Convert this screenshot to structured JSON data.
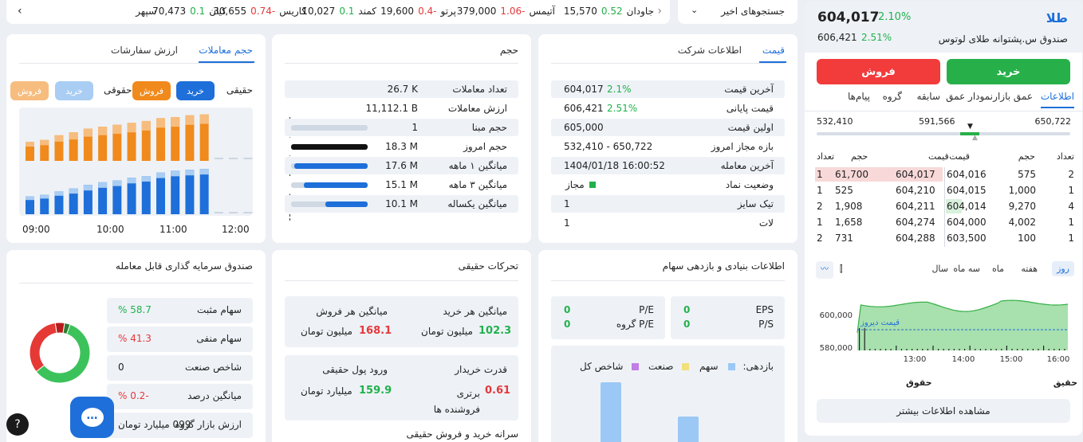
{
  "ticker": {
    "recent_label": "جستجوهای اخیر",
    "items": [
      {
        "name": "جاودان",
        "change": "0.52",
        "value": "15,570",
        "dir": "up"
      },
      {
        "name": "آتیمس",
        "change": "-1.06",
        "value": "379,000",
        "dir": "down"
      },
      {
        "name": "پرتو",
        "change": "-0.4",
        "value": "19,600",
        "dir": "down"
      },
      {
        "name": "کمند",
        "change": "0.1",
        "value": "10,027",
        "dir": "up"
      },
      {
        "name": "کاریس",
        "change": "-0.74",
        "value": "30,655",
        "dir": "down"
      },
      {
        "name": "کیان",
        "change": "0.1",
        "value": "70,473",
        "dir": "up"
      },
      {
        "name": "سپهر",
        "change": "",
        "value": "",
        "dir": "up"
      }
    ]
  },
  "side": {
    "symbol": "طلا",
    "fund_name": "صندوق س.پشتوانه طلای لوتوس",
    "last_price": "604,017",
    "last_change": "2.10%",
    "close_price": "606,421",
    "close_change": "2.51%",
    "buy": "خرید",
    "sell": "فروش",
    "tabs": [
      "اطلاعات",
      "عمق بازار",
      "نمودار عمق",
      "سابقه",
      "گروه",
      "پیام‌ها"
    ],
    "range": {
      "low": "532,410",
      "mid": "591,566",
      "high": "650,722"
    },
    "ob_headers": {
      "count": "تعداد",
      "volume": "حجم",
      "price": "قیمت"
    },
    "orderbook": [
      {
        "bc": "2",
        "bv": "575",
        "bp": "604,016",
        "sp": "604,017",
        "sv": "61,700",
        "sc": "1"
      },
      {
        "bc": "1",
        "bv": "1,000",
        "bp": "604,015",
        "sp": "604,210",
        "sv": "525",
        "sc": "1"
      },
      {
        "bc": "4",
        "bv": "9,270",
        "bp": "604,014",
        "sp": "604,211",
        "sv": "1,908",
        "sc": "2"
      },
      {
        "bc": "1",
        "bv": "4,002",
        "bp": "604,000",
        "sp": "604,274",
        "sv": "1,658",
        "sc": "1"
      },
      {
        "bc": "1",
        "bv": "100",
        "bp": "603,500",
        "sp": "604,288",
        "sv": "731",
        "sc": "2"
      }
    ],
    "periods": [
      "روز",
      "هفته",
      "ماه",
      "سه ماه",
      "سال"
    ],
    "chart_y": [
      "600,000",
      "580,000"
    ],
    "chart_x": [
      "13:00",
      "14:00",
      "15:00",
      "16:00"
    ],
    "yesterday_label": "قیمت دیروز",
    "hq_labels": [
      "حقوق",
      "حقیق"
    ],
    "more": "مشاهده اطلاعات بیشتر"
  },
  "price_card": {
    "tabs": [
      "قیمت",
      "اطلاعات شرکت"
    ],
    "rows": [
      {
        "label": "آخرین قیمت",
        "value": "604,017",
        "change": "2.1%"
      },
      {
        "label": "قیمت پایانی",
        "value": "606,421",
        "change": "2.51%"
      },
      {
        "label": "اولین قیمت",
        "value": "605,000",
        "change": ""
      },
      {
        "label": "بازه مجاز امروز",
        "value": "532,410 - 650,722",
        "change": ""
      },
      {
        "label": "آخرین معامله",
        "value": "1404/01/18 16:00:52",
        "change": ""
      },
      {
        "label": "وضعیت نماد",
        "value": "مجاز",
        "change": ""
      },
      {
        "label": "تیک سایز",
        "value": "1",
        "change": ""
      },
      {
        "label": "لات",
        "value": "1",
        "change": ""
      }
    ]
  },
  "volume_card": {
    "title": "حجم",
    "rows": [
      {
        "label": "تعداد معاملات",
        "value": "26.7 K",
        "fill": 0
      },
      {
        "label": "ارزش معاملات",
        "value": "11,112.1 B",
        "fill": 0
      },
      {
        "label": "حجم مبنا",
        "value": "1",
        "fill": 0.0
      },
      {
        "label": "حجم امروز",
        "value": "18.3 M",
        "fill": 1.0
      },
      {
        "label": "میانگین ۱ ماهه",
        "value": "17.6 M",
        "fill": 0.96
      },
      {
        "label": "میانگین ۳ ماهه",
        "value": "15.1 M",
        "fill": 0.83
      },
      {
        "label": "میانگین یکساله",
        "value": "10.1 M",
        "fill": 0.55
      }
    ]
  },
  "trades_card": {
    "tabs": [
      "حجم معاملات",
      "ارزش سفارشات"
    ],
    "legend": {
      "haghighi1": "حقیقی",
      "kharid": "خرید",
      "forush": "فروش",
      "haghighi2": "حقوقی",
      "kharid2": "خرید",
      "forush2": "فروش"
    },
    "times": [
      "09:00",
      "10:00",
      "11:00",
      "12:00"
    ],
    "sell_vals": [
      20,
      22,
      27,
      30,
      34,
      36,
      38,
      40,
      42,
      45,
      46,
      48,
      49,
      0,
      0,
      0
    ],
    "buy_vals": [
      20,
      22,
      26,
      29,
      33,
      36,
      38,
      41,
      43,
      47,
      49,
      50,
      51,
      0,
      0,
      0
    ]
  },
  "fundamental_card": {
    "title": "اطلاعات بنیادی و بازدهی سهام",
    "eps_label": "EPS",
    "eps": "0",
    "ps_label": "P/S",
    "ps": "0",
    "pe_label": "P/E",
    "pe": "0",
    "peg_label": "P/E گروه",
    "peg": "0",
    "ret_label": "بازدهی:",
    "legend": [
      "سهم",
      "صنعت",
      "شاخص کل"
    ]
  },
  "real_card": {
    "title": "تحرکات حقیقی",
    "avg_buy_label": "میانگین هر خرید",
    "avg_buy": "102.3",
    "avg_buy_unit": "میلیون تومان",
    "avg_sell_label": "میانگین هر فروش",
    "avg_sell": "168.1",
    "avg_sell_unit": "میلیون تومان",
    "power_label": "قدرت خریدار",
    "power": "0.61",
    "power_unit": "برتری فروشنده ها",
    "inflow_label": "ورود پول حقیقی",
    "inflow": "159.9",
    "inflow_unit": "میلیارد تومان",
    "footer": "سرانه خرید و فروش حقیقی"
  },
  "fund_card": {
    "title": "صندوق سرمایه گذاری قابل معامله",
    "rows": [
      {
        "label": "سهام مثبت",
        "value": "58.7 %",
        "tone": "up"
      },
      {
        "label": "سهام منفی",
        "value": "41.3 %",
        "tone": "down"
      },
      {
        "label": "شاخص صنعت",
        "value": "0",
        "tone": "neutral"
      },
      {
        "label": "میانگین درصد",
        "value": "-0.2 %",
        "tone": "down"
      },
      {
        "label": "ارزش بازار گروه",
        "value": "099 میلیارد تومان",
        "tone": "neutral"
      }
    ],
    "donut": [
      {
        "value": 58.7,
        "color": "#3cc25a"
      },
      {
        "value": 41.3,
        "color": "#e53935"
      }
    ]
  },
  "colors": {
    "green": "#22b14c",
    "red": "#e5383b",
    "blue": "#1e6fd9",
    "orange": "#f08a1c"
  }
}
